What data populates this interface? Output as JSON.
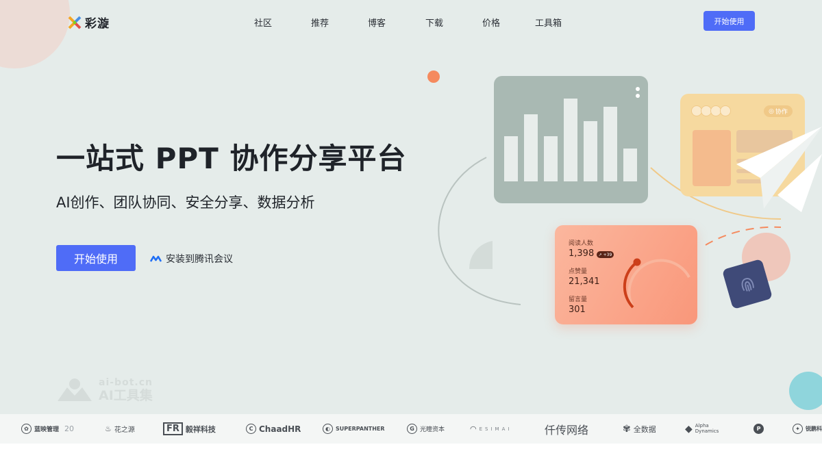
{
  "brand": {
    "name": "彩漩"
  },
  "nav": {
    "items": [
      "社区",
      "推荐",
      "博客",
      "下载",
      "价格",
      "工具箱"
    ]
  },
  "header": {
    "cta_label": "开始使用"
  },
  "hero": {
    "title": "一站式 PPT 协作分享平台",
    "subtitle": "AI创作、团队协同、安全分享、数据分析",
    "cta_label": "开始使用",
    "meeting_link": "安装到腾讯会议"
  },
  "watermark": {
    "line1": "ai-bot.cn",
    "line2": "AI工具集"
  },
  "stats_card": {
    "read_label": "阅读人数",
    "read_value": "1,398",
    "read_chip": "↗ +39",
    "like_label": "点赞量",
    "like_value": "21,341",
    "comment_label": "留言量",
    "comment_value": "301"
  },
  "collab_card": {
    "badge": "协作"
  },
  "bar_chart": {
    "values": [
      0.53,
      0.78,
      0.53,
      0.97,
      0.7,
      0.87,
      0.38
    ]
  },
  "partners": [
    {
      "name": "蓝映管理",
      "extra": "20"
    },
    {
      "name": "花之源"
    },
    {
      "name": "毅祥科技"
    },
    {
      "name": "ChaadHR"
    },
    {
      "name": "SUPERPANTHER"
    },
    {
      "name": "光瞳资本"
    },
    {
      "name": "ESIMAI"
    },
    {
      "name": "仟传网络"
    },
    {
      "name": "全数据"
    },
    {
      "name": "Alpha Dynamics"
    },
    {
      "name": "P"
    },
    {
      "name": "锐鹏科技"
    }
  ],
  "colors": {
    "primary": "#4f6cf7",
    "hero_bg": "#e5ecea",
    "accent_orange": "#f58a5e"
  }
}
